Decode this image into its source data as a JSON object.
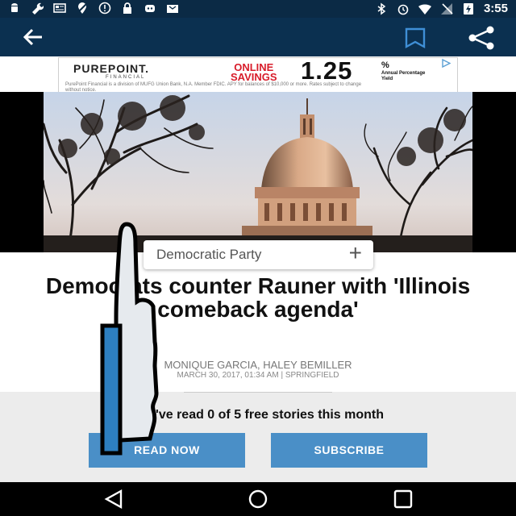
{
  "status_bar": {
    "time": "3:55",
    "left_icons": [
      "android-icon",
      "wrench-icon",
      "news-icon",
      "location-off-icon",
      "alert-icon",
      "lock-icon",
      "game-icon",
      "inbox-icon"
    ],
    "right_icons": [
      "bluetooth-icon",
      "alarm-icon",
      "wifi-icon",
      "signal-icon",
      "battery-icon"
    ]
  },
  "app_bar": {
    "actions": [
      "back-arrow-icon",
      "bookmark-icon",
      "share-icon"
    ]
  },
  "ad": {
    "brand": "PUREPOINT.",
    "brand_sub": "FINANCIAL",
    "offer_line1": "ONLINE",
    "offer_line2": "SAVINGS",
    "rate": "1.25",
    "percent": "%",
    "rate_label": "Annual Percentage Yield",
    "disclaimer": "PurePoint Financial is a division of MUFG Union Bank, N.A. Member FDIC. APY for balances of $10,000 or more. Rates subject to change without notice."
  },
  "article": {
    "topic": "Democratic Party",
    "topic_action": "+",
    "headline": "Democrats counter Rauner with 'Illinois comeback agenda'",
    "byline": "MONIQUE GARCIA, HALEY BEMILLER",
    "dateline": "MARCH 30, 2017, 01:34 AM | SPRINGFIELD"
  },
  "paywall": {
    "message": "You've read 0 of 5 free stories this month",
    "read_now": "READ NOW",
    "subscribe": "SUBSCRIBE"
  },
  "nav_bar": {
    "buttons": [
      "nav-back-icon",
      "nav-home-icon",
      "nav-recents-icon"
    ]
  },
  "colors": {
    "status_bar": "#0b2a45",
    "app_bar": "#0b3050",
    "button": "#4a8fc7",
    "paywall_bg": "#ececec",
    "ad_red": "#d81c2a"
  }
}
